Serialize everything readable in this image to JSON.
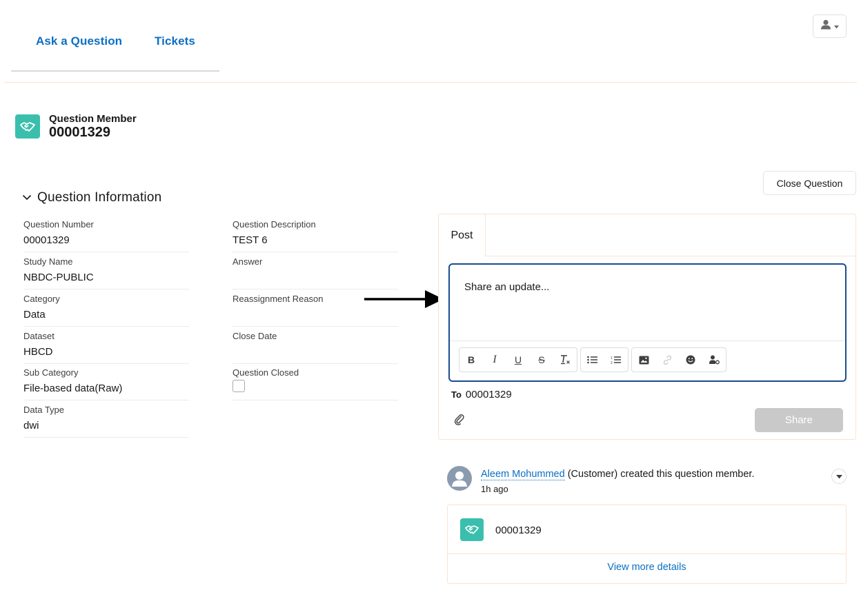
{
  "nav": {
    "tabs": [
      {
        "label": "Ask a Question"
      },
      {
        "label": "Tickets"
      }
    ],
    "user_menu_icon": "user-icon"
  },
  "record": {
    "type_label": "Question Member",
    "name": "00001329",
    "icon": "handshake-icon",
    "icon_color": "#3bbfad"
  },
  "section": {
    "title": "Question Information",
    "left_fields": [
      {
        "label": "Question Number",
        "value": "00001329"
      },
      {
        "label": "Study Name",
        "value": "NBDC-PUBLIC"
      },
      {
        "label": "Category",
        "value": "Data"
      },
      {
        "label": "Dataset",
        "value": "HBCD"
      },
      {
        "label": "Sub Category",
        "value": "File-based data(Raw)"
      },
      {
        "label": "Data Type",
        "value": "dwi"
      }
    ],
    "right_fields": [
      {
        "label": "Question Description",
        "value": "TEST 6"
      },
      {
        "label": "Answer",
        "value": ""
      },
      {
        "label": "Reassignment Reason",
        "value": ""
      },
      {
        "label": "Close Date",
        "value": ""
      },
      {
        "label": "Question Closed",
        "checked": false
      }
    ]
  },
  "actions": {
    "close_question": "Close Question"
  },
  "publisher": {
    "tab": "Post",
    "placeholder": "Share an update...",
    "toolbar": [
      "bold",
      "italic",
      "underline",
      "strikethrough",
      "clear-formatting",
      "bulleted-list",
      "numbered-list",
      "image",
      "link",
      "emoji",
      "mention"
    ],
    "to_label": "To",
    "to_value": "00001329",
    "share": "Share",
    "accent_color": "#1a4c8b"
  },
  "feed": {
    "author": "Aleem Mohummed",
    "action": " (Customer) created this question member.",
    "time": "1h ago",
    "card_name": "00001329",
    "card_link": "View more details"
  },
  "colors": {
    "link": "#0b6fc4",
    "brand_teal": "#3bbfad",
    "disabled_button": "#c9c9c9"
  }
}
